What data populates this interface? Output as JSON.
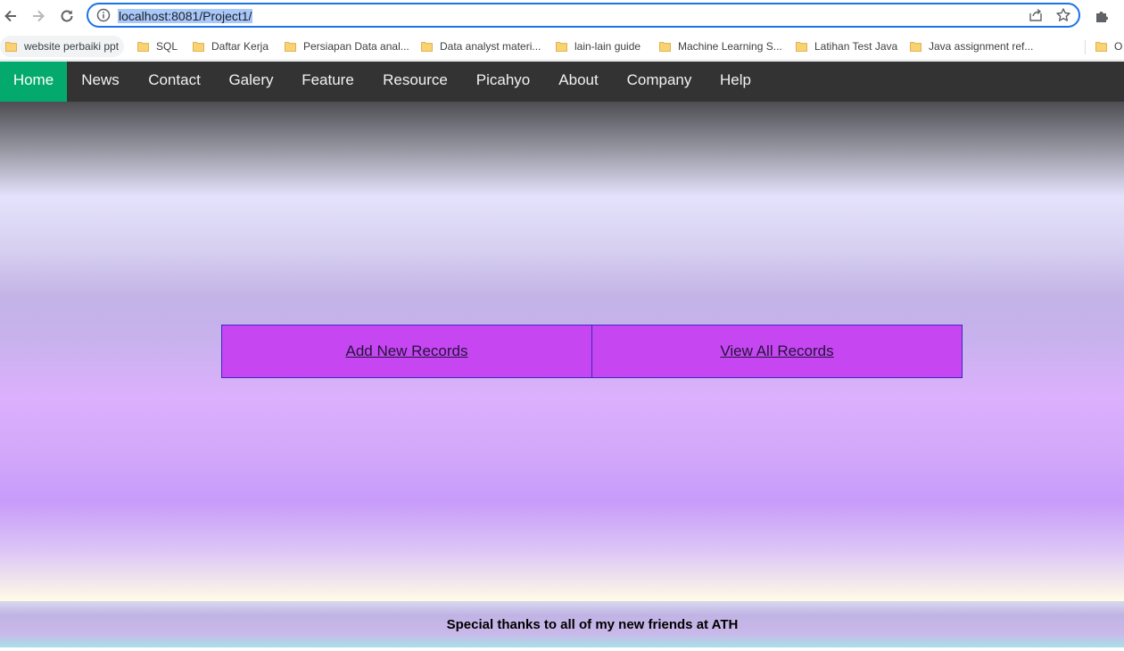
{
  "browser": {
    "url": "localhost:8081/Project1/",
    "bookmarks": [
      {
        "label": "website perbaiki ppt"
      },
      {
        "label": "SQL"
      },
      {
        "label": "Daftar Kerja"
      },
      {
        "label": "Persiapan Data anal..."
      },
      {
        "label": "Data analyst materi..."
      },
      {
        "label": "lain-lain guide"
      },
      {
        "label": "Machine Learning S..."
      },
      {
        "label": "Latihan Test Java"
      },
      {
        "label": "Java assignment ref..."
      },
      {
        "label": "O"
      }
    ],
    "colors": {
      "focus_ring": "#1a73e8",
      "url_selection": "#a8c7fa",
      "folder": "#f9d371"
    }
  },
  "nav": {
    "items": [
      {
        "label": "Home",
        "active": true
      },
      {
        "label": "News"
      },
      {
        "label": "Contact"
      },
      {
        "label": "Galery"
      },
      {
        "label": "Feature"
      },
      {
        "label": "Resource"
      },
      {
        "label": "Picahyo"
      },
      {
        "label": "About"
      },
      {
        "label": "Company"
      },
      {
        "label": "Help"
      }
    ],
    "colors": {
      "background": "#333333",
      "active": "#04aa6d",
      "text": "#f2f2f2"
    }
  },
  "records": {
    "add_label": "Add New Records",
    "view_label": "View All Records",
    "colors": {
      "background": "#c646f2",
      "border": "#3a2ac2"
    }
  },
  "footer": {
    "text": "Special thanks to all of my new friends at ATH"
  }
}
